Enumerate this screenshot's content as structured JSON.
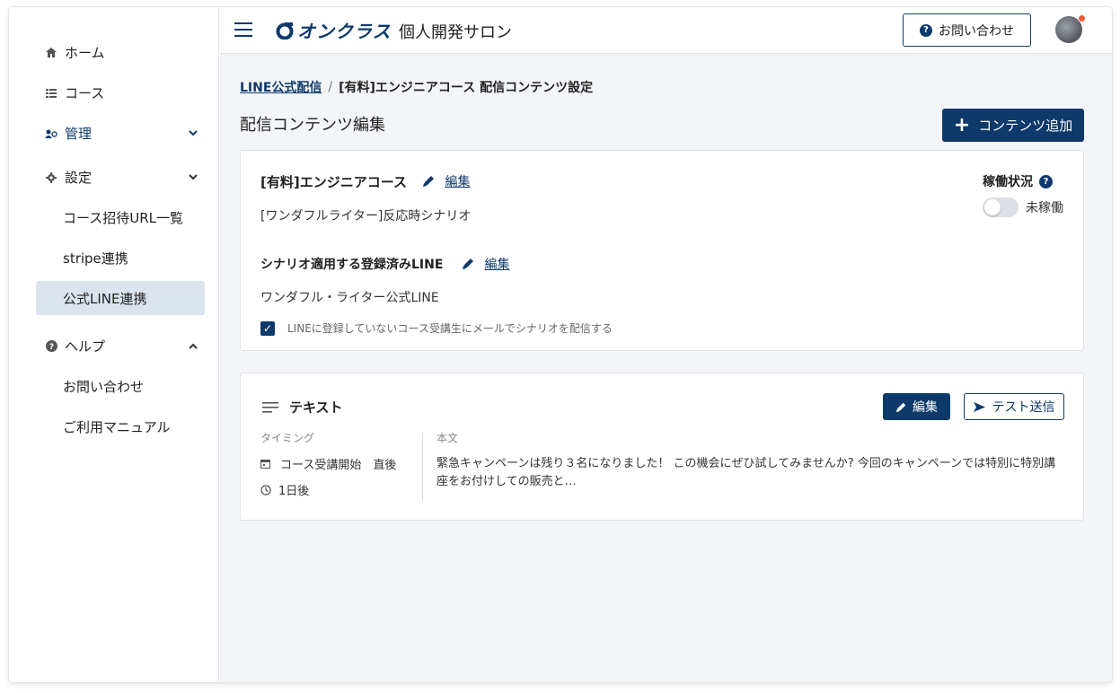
{
  "sidebar": {
    "items": [
      {
        "label": "ホーム",
        "icon": "home-icon"
      },
      {
        "label": "コース",
        "icon": "list-icon"
      },
      {
        "label": "管理",
        "icon": "users-icon"
      },
      {
        "label": "設定",
        "icon": "gear-icon"
      },
      {
        "label": "ヘルプ",
        "icon": "question-icon"
      }
    ],
    "settings_sub": [
      "コース招待URL一覧",
      "stripe連携",
      "公式LINE連携"
    ],
    "help_sub": [
      "お問い合わせ",
      "ご利用マニュアル"
    ]
  },
  "header": {
    "logo_text": "オンクラス",
    "site_title": "個人開発サロン",
    "contact_label": "お問い合わせ"
  },
  "breadcrumb": {
    "link": "LINE公式配信",
    "separator": "/",
    "current": "[有料]エンジニアコース 配信コンテンツ設定"
  },
  "page": {
    "title": "配信コンテンツ編集",
    "add_button": "コンテンツ追加"
  },
  "scenario": {
    "course_name": "[有料]エンジニアコース",
    "edit_label": "編集",
    "scenario_name": "[ワンダフルライター]反応時シナリオ",
    "status_label": "稼働状況",
    "status_value": "未稼働",
    "line_heading": "シナリオ適用する登録済みLINE",
    "line_edit_label": "編集",
    "line_name": "ワンダフル・ライター公式LINE",
    "checkbox_label": "LINEに登録していないコース受講生にメールでシナリオを配信する",
    "checkbox_checked": true
  },
  "content": {
    "type_label": "テキスト",
    "edit_button": "編集",
    "test_button": "テスト送信",
    "timing_label": "タイミング",
    "timing_trigger": "コース受講開始　直後",
    "timing_delay": "1日後",
    "body_label": "本文",
    "body_line1": "緊急キャンペーンは残り３名になりました！ この機会にぜひ試してみませんか? 今回のキャンペーンでは特別に特別講",
    "body_line2": "座をお付けしての販売と…"
  },
  "colors": {
    "brand": "#0e3a6b",
    "notification_dot": "#f05a3a",
    "selected_nav_bg": "#dbe3ee"
  }
}
